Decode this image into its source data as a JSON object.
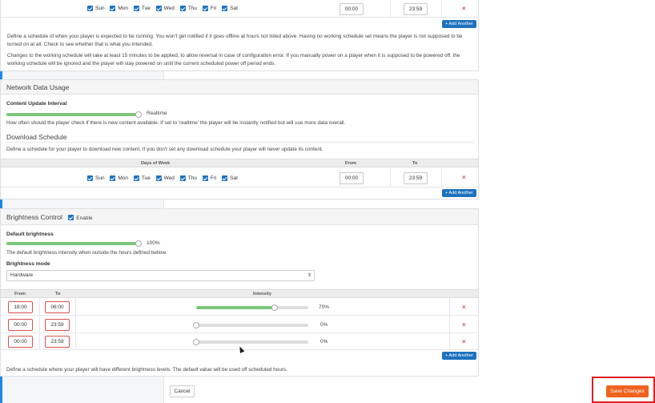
{
  "days": [
    "Sun",
    "Mon",
    "Tue",
    "Wed",
    "Thu",
    "Fri",
    "Sat"
  ],
  "working_schedule": {
    "from": "00:00",
    "to": "23:59",
    "add_another": "+ Add Another",
    "remove": "×",
    "desc1": "Define a schedule of when your player is expected to be running. You won't get notified if it goes offline at hours not listed above. Having no working schedule set means the player is not supposed to be turned on at all. Check to see whether that is what you intended.",
    "desc2": "Changes to the working schedule will take at least 15 minutes to be applied, to allow reversal in case of configuration error. If you manually power on a player when it is supposed to be powered off, the working schedule will be ignored and the player will stay powered on until the current scheduled power off period ends."
  },
  "network": {
    "title": "Network Data Usage",
    "content_update_label": "Content Update Interval",
    "content_update_value": "Realtime",
    "content_update_level": 1.0,
    "content_update_desc": "How often should the player check if there is new content available. If set to 'realtime' the player will be instantly notified but will use more data overall.",
    "download_title": "Download Schedule",
    "download_desc": "Define a schedule for your player to download new content. If you don't set any download schedule your player will never update its content.",
    "col_days": "Days of Week",
    "col_from": "From",
    "col_to": "To",
    "from": "00:00",
    "to": "23:59",
    "add_another": "+ Add Another",
    "remove": "×"
  },
  "brightness": {
    "title": "Brightness Control",
    "enable_label": "Enable",
    "default_label": "Default brightness",
    "default_value": "100%",
    "default_level": 1.0,
    "default_desc": "The default brightness intensity when outside the hours defined bellow.",
    "mode_label": "Brightness mode",
    "mode_value": "Hardware",
    "col_from": "From",
    "col_to": "To",
    "col_intensity": "Intensity",
    "rows": [
      {
        "from": "18:00",
        "to": "06:00",
        "intensity": "70%",
        "level": 0.7
      },
      {
        "from": "00:00",
        "to": "23:59",
        "intensity": "0%",
        "level": 0.0
      },
      {
        "from": "00:00",
        "to": "23:59",
        "intensity": "0%",
        "level": 0.0
      }
    ],
    "add_another": "+ Add Another",
    "remove": "×",
    "footer_desc": "Define a schedule where your player will have different brightness levels. The default value will be used off scheduled hours."
  },
  "footer": {
    "cancel": "Cancel",
    "save": "Save Changes"
  }
}
